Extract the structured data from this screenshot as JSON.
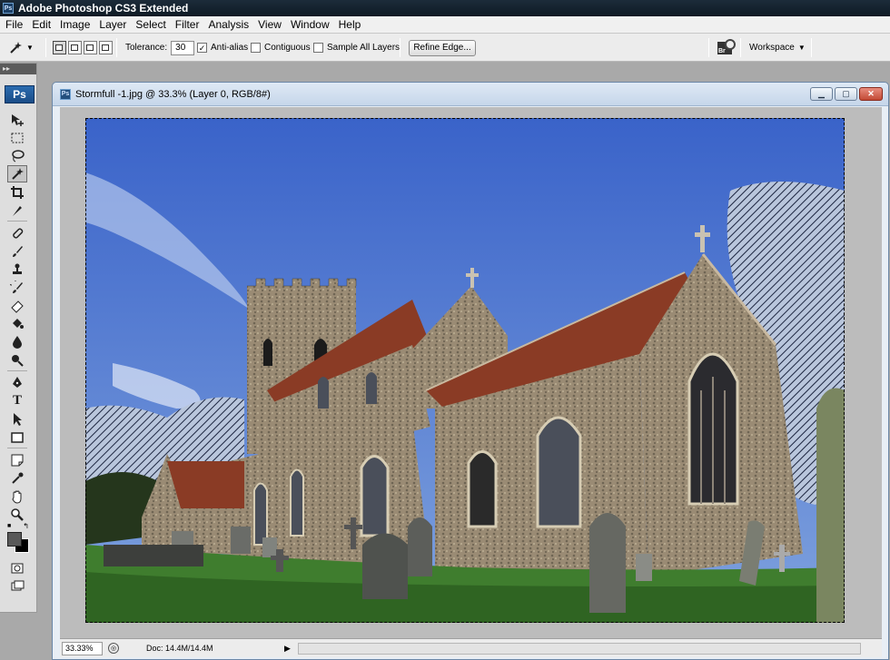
{
  "app": {
    "title": "Adobe Photoshop CS3 Extended",
    "icon": "ps-app-icon",
    "logo_text": "Ps"
  },
  "menu": [
    "File",
    "Edit",
    "Image",
    "Layer",
    "Select",
    "Filter",
    "Analysis",
    "View",
    "Window",
    "Help"
  ],
  "options": {
    "tool_preset_icon": "magic-wand-icon",
    "tolerance_label": "Tolerance:",
    "tolerance_value": "30",
    "anti_alias_label": "Anti-alias",
    "anti_alias_checked": true,
    "contiguous_label": "Contiguous",
    "contiguous_checked": false,
    "sample_all_layers_label": "Sample All Layers",
    "sample_all_layers_checked": false,
    "refine_edge_label": "Refine Edge...",
    "workspace_label": "Workspace"
  },
  "toolbox": {
    "active_tool": "magic-wand-tool",
    "tools": [
      "move",
      "marquee",
      "lasso",
      "magic-wand",
      "crop",
      "slice",
      "healing-brush",
      "brush",
      "clone-stamp",
      "history-brush",
      "eraser",
      "paint-bucket",
      "blur",
      "dodge",
      "pen",
      "type",
      "path-selection",
      "shape",
      "notes",
      "eyedropper",
      "hand",
      "zoom"
    ],
    "foreground_color": "#595959",
    "background_color": "#000000"
  },
  "document": {
    "title": "Stormfull -1.jpg @ 33.3% (Layer 0, RGB/8#)",
    "zoom": "33.33%",
    "doc_size": "Doc: 14.4M/14.4M"
  },
  "colors": {
    "sky_top": "#3a63c9",
    "sky_bottom": "#7fa2de",
    "grass": "#3f7d2e",
    "roof": "#8a3b25",
    "stone": "#9a8b74"
  }
}
